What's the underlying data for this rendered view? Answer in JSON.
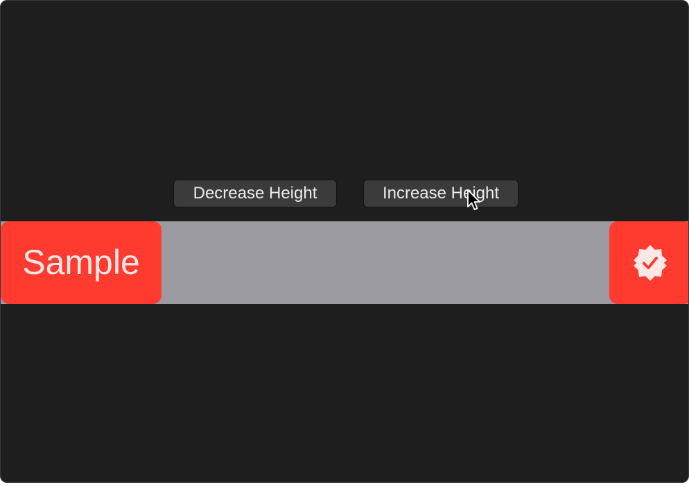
{
  "toolbar": {
    "decrease_label": "Decrease Height",
    "increase_label": "Increase Height"
  },
  "content": {
    "sample_label": "Sample",
    "verified_icon": "checkmark-seal-icon"
  },
  "colors": {
    "window_background": "#1e1e1e",
    "strip_background": "#9b9aa0",
    "accent_red": "#ff3b30",
    "button_background": "#3b3b3b",
    "button_text": "#ececec"
  }
}
